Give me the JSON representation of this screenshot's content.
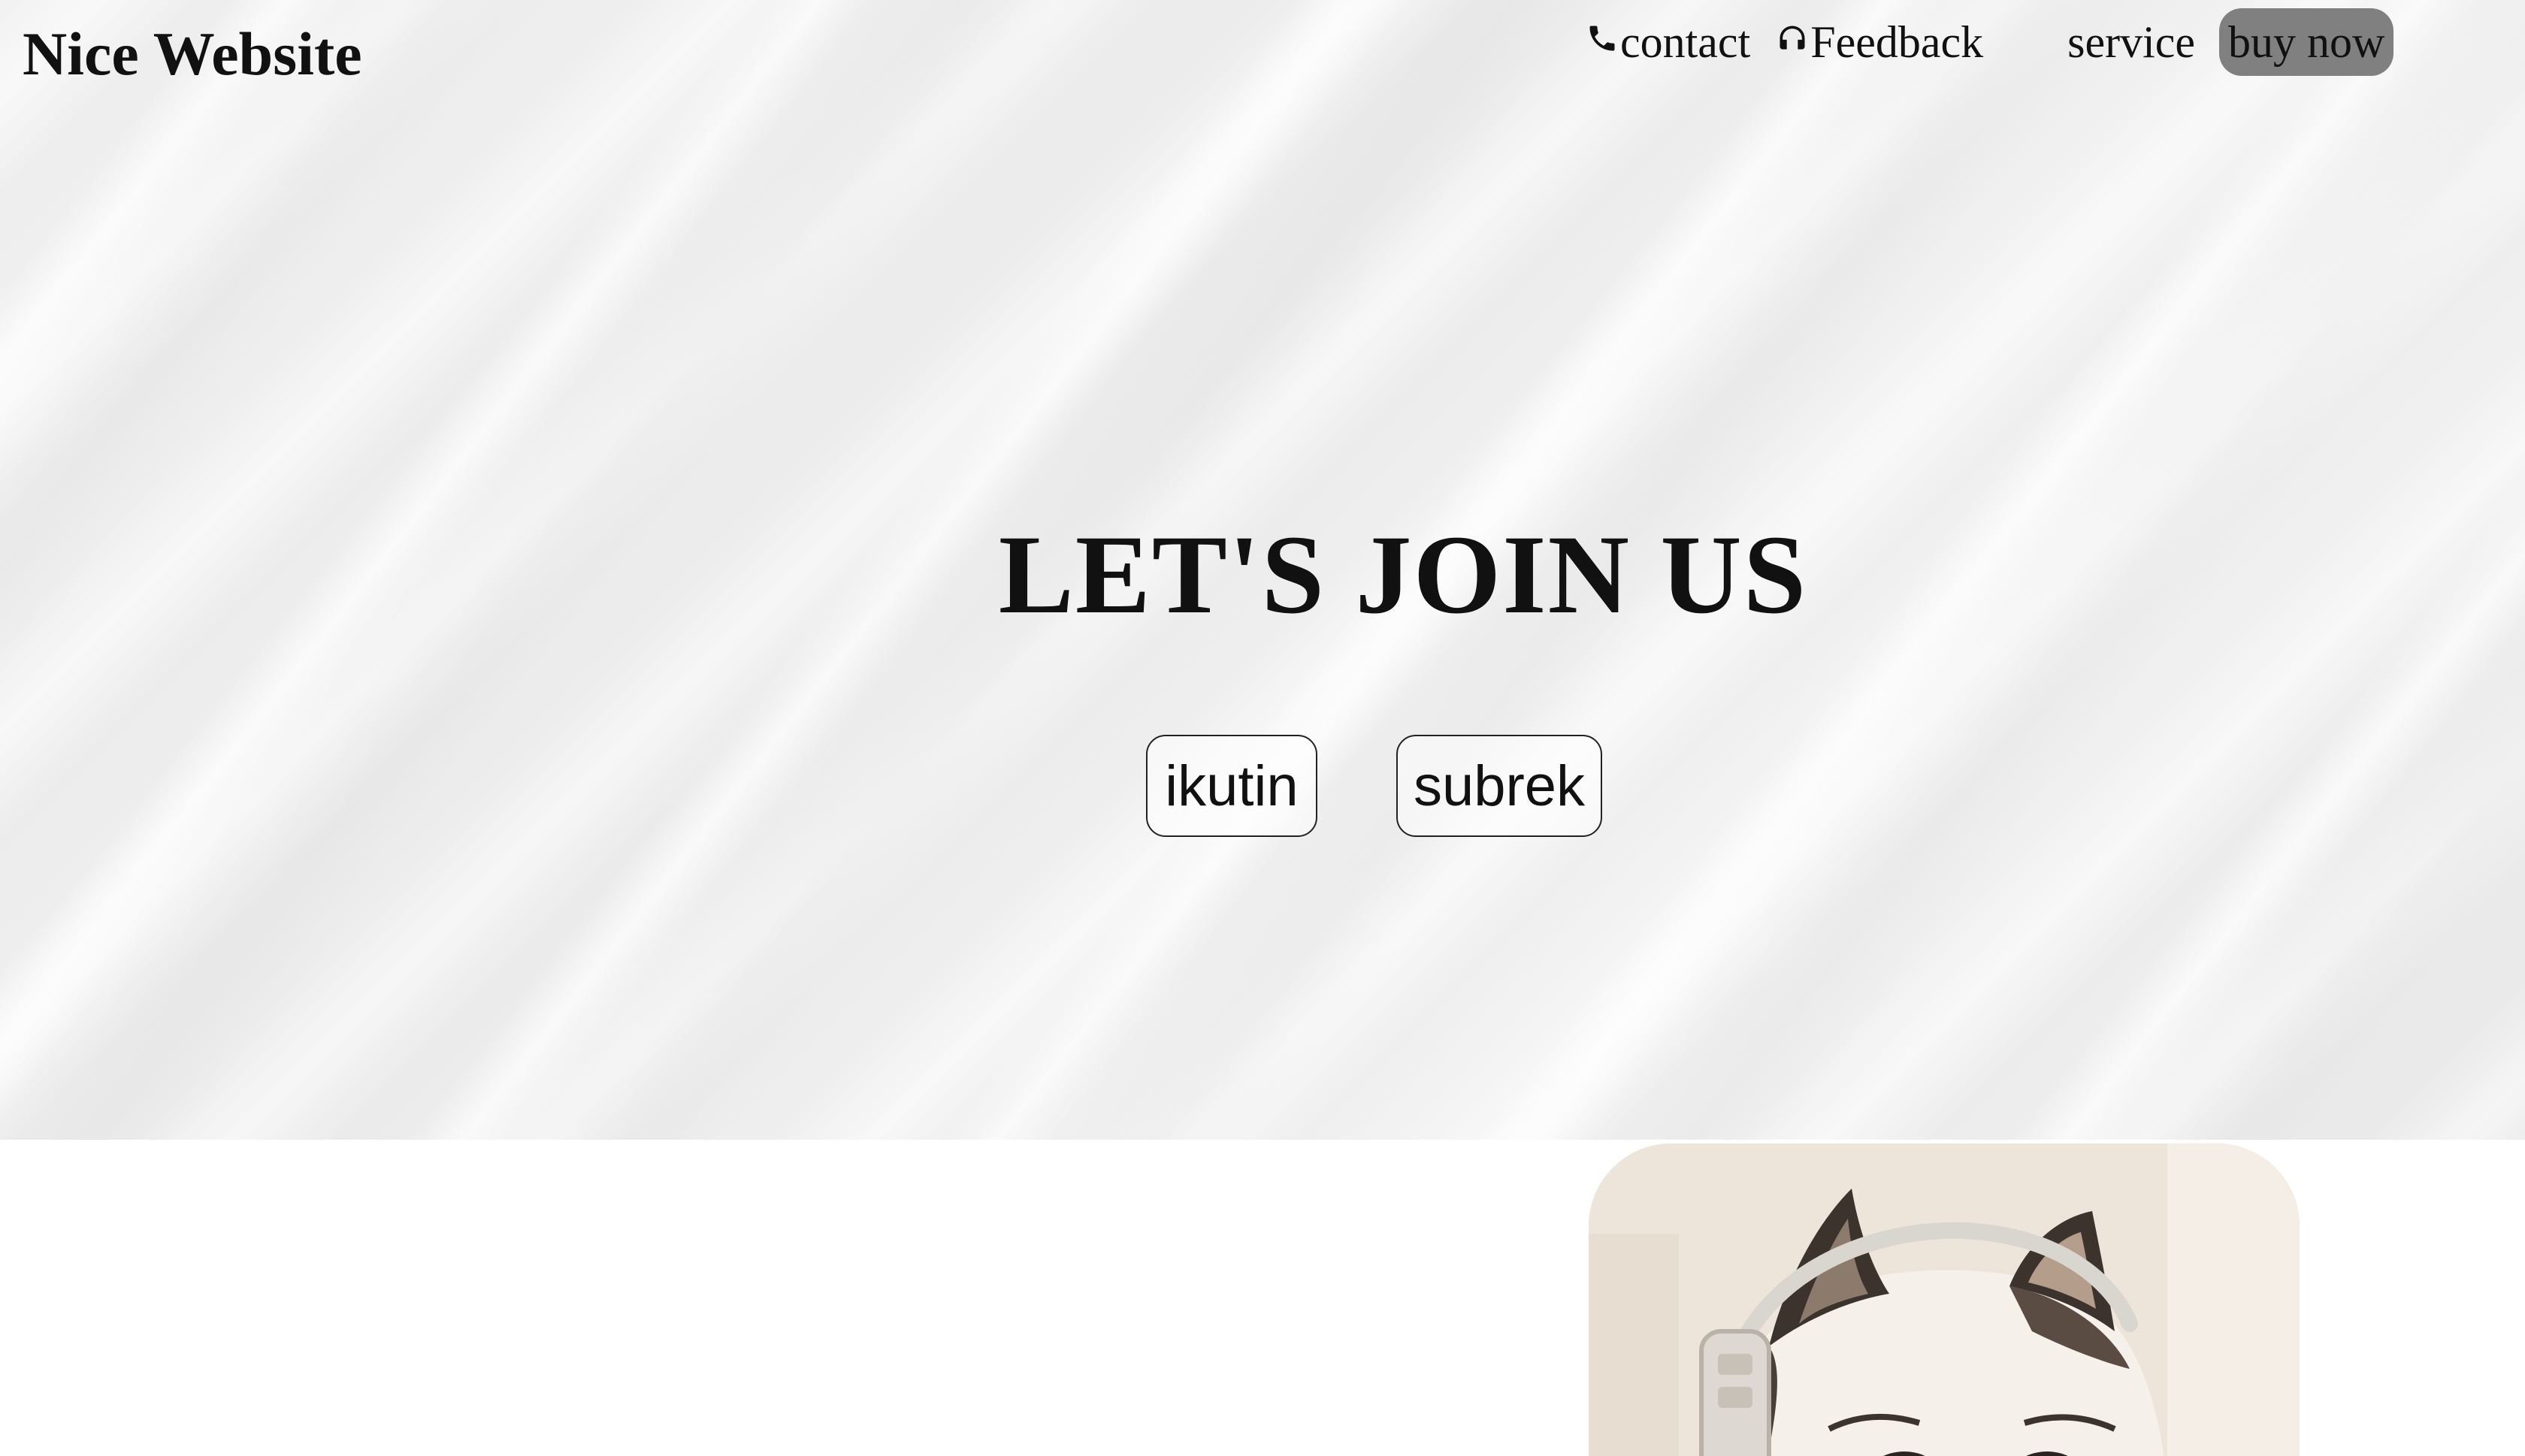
{
  "header": {
    "brand": "Nice Website",
    "nav": {
      "contact": "contact",
      "feedback": "Feedback",
      "service": "service",
      "buy_now": "buy now"
    }
  },
  "hero": {
    "headline": "LET'S JOIN US",
    "buttons": {
      "ikutin": "ikutin",
      "subrek": "subrek"
    }
  },
  "icons": {
    "contact": "phone-icon",
    "feedback": "headphones-icon"
  },
  "colors": {
    "buy_now_bg": "#808080",
    "text": "#111111"
  }
}
